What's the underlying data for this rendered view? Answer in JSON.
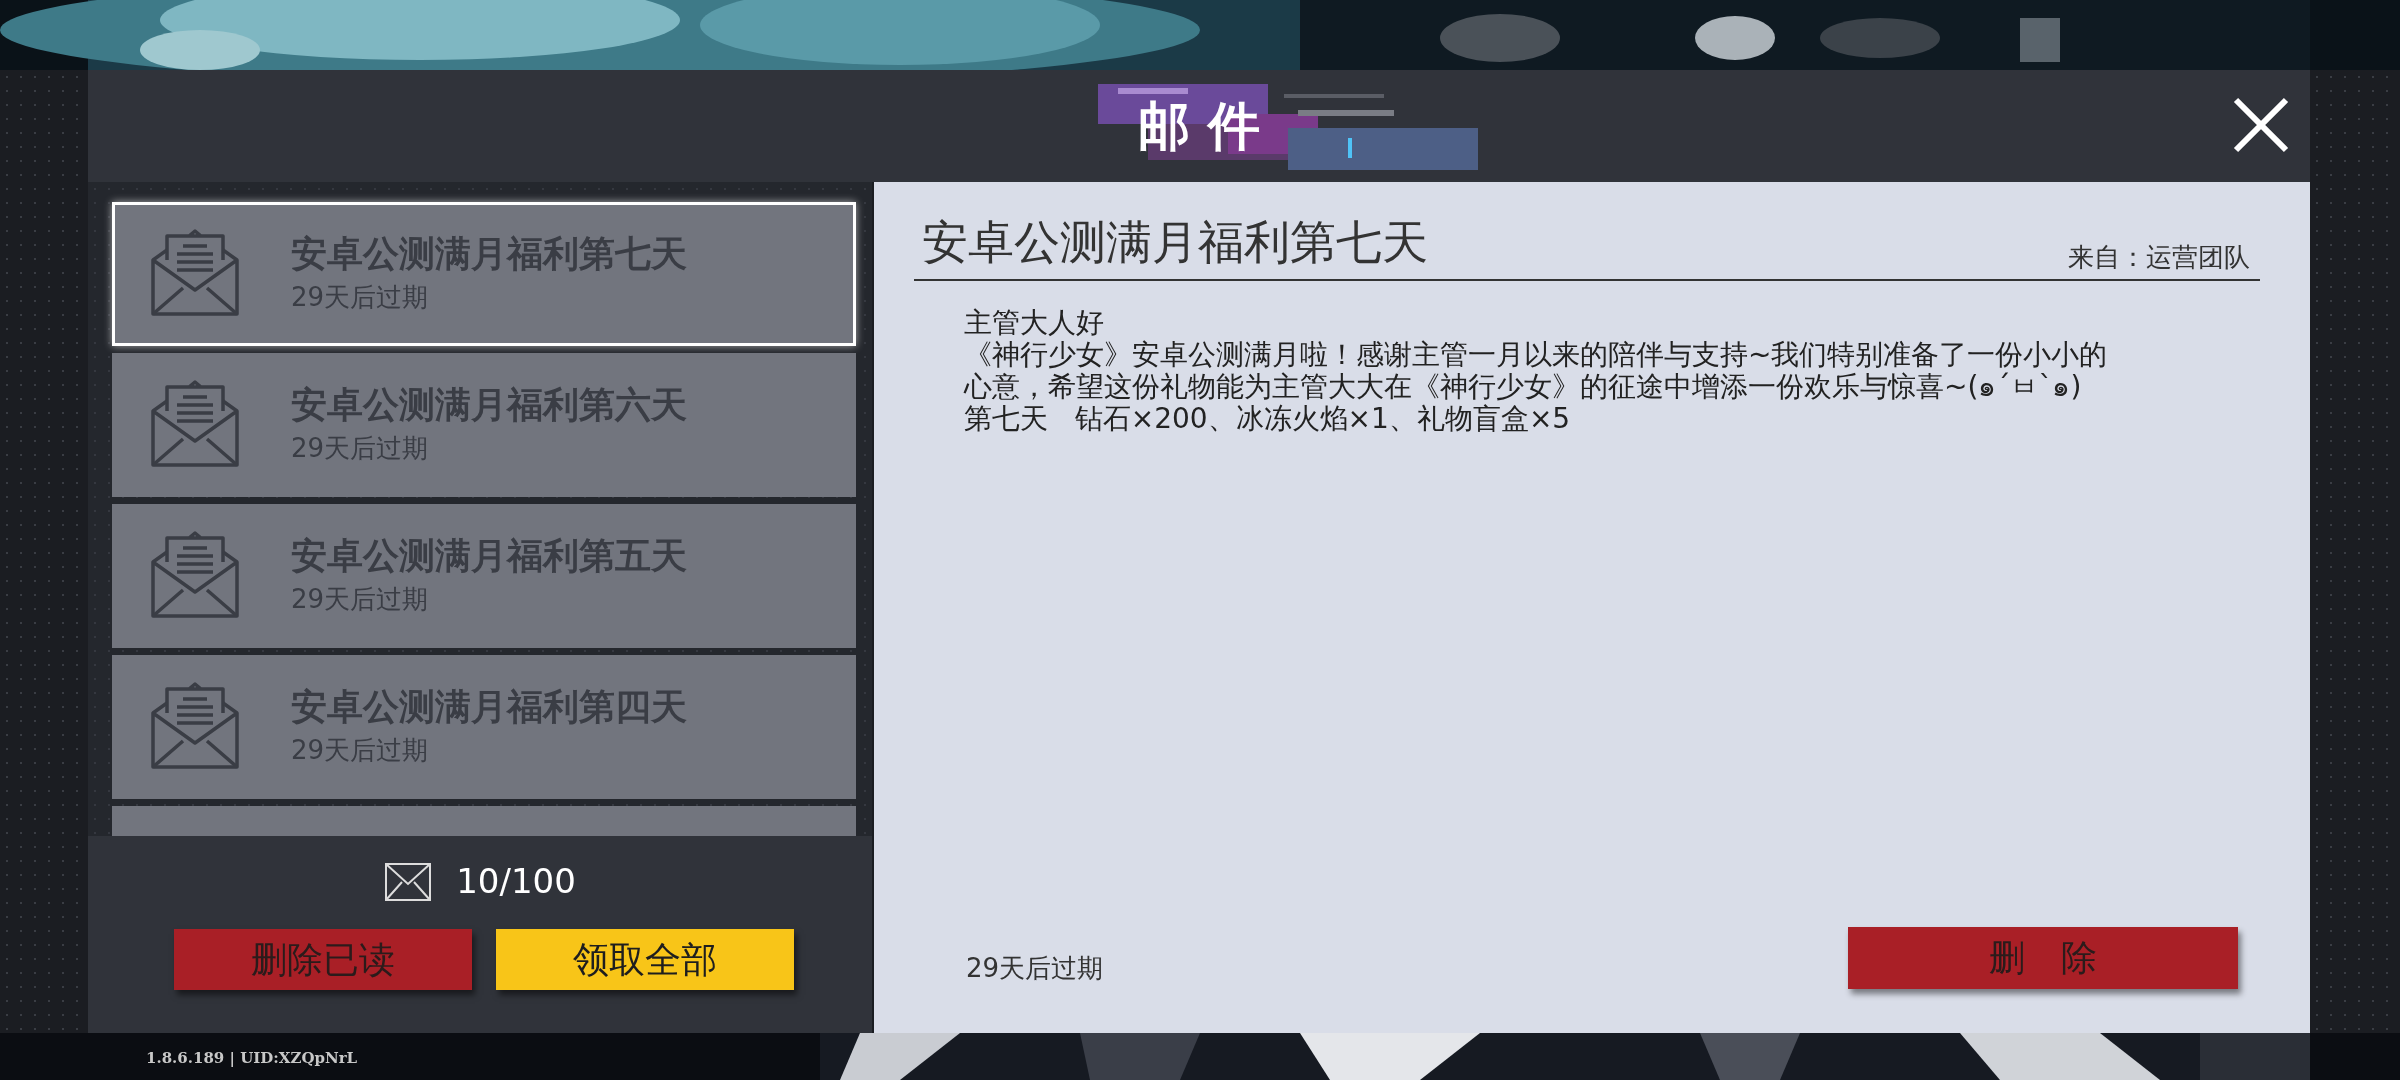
{
  "header": {
    "title": "邮 件"
  },
  "mails": [
    {
      "title": "安卓公测满月福利第七天",
      "expiry": "29天后过期",
      "selected": true
    },
    {
      "title": "安卓公测满月福利第六天",
      "expiry": "29天后过期",
      "selected": false
    },
    {
      "title": "安卓公测满月福利第五天",
      "expiry": "29天后过期",
      "selected": false
    },
    {
      "title": "安卓公测满月福利第四天",
      "expiry": "29天后过期",
      "selected": false
    }
  ],
  "mail_count": "10/100",
  "list_buttons": [
    {
      "label": "删除已读",
      "kind": "danger"
    },
    {
      "label": "领取全部",
      "kind": "warning"
    }
  ],
  "detail": {
    "title": "安卓公测满月福利第七天",
    "sender": "来自：运营团队",
    "body": [
      "主管大人好",
      "《神行少女》安卓公测满月啦！感谢主管一月以来的陪伴与支持~我们特别准备了一份小小的",
      "心意，希望这份礼物能为主管大大在《神行少女》的征途中增添一份欢乐与惊喜~(๑´ㅂ`๑)",
      "第七天   钻石×200、冰冻火焰×1、礼物盲盒×5"
    ],
    "expiry": "29天后过期",
    "delete_button": "删　除"
  },
  "footer": {
    "version": "1.8.6.189 | UID:XZQpNrL"
  }
}
